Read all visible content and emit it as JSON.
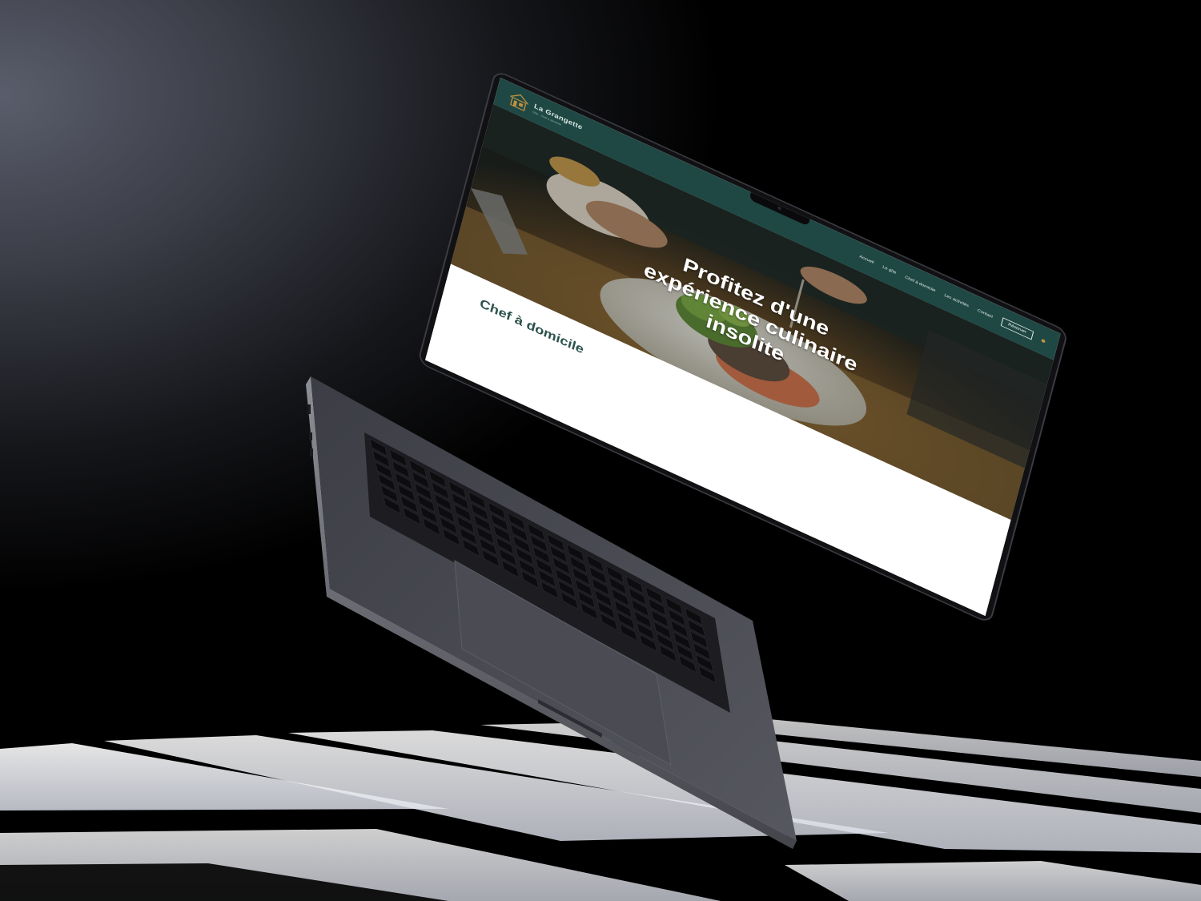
{
  "navbar": {
    "brand_name": "La Grangette",
    "brand_tagline": "Gîte · Chef à domicile",
    "links": [
      {
        "label": "Accueil"
      },
      {
        "label": "Le gîte"
      },
      {
        "label": "Chef à domicile"
      },
      {
        "label": "Les activités"
      },
      {
        "label": "Contact"
      }
    ],
    "cta_label": "Réserver"
  },
  "hero": {
    "title": "Profitez d'une expérience culinaire insolite",
    "subtitle": ""
  },
  "section": {
    "title": "Chef à domicile"
  },
  "colors": {
    "brand_green": "#1f4844",
    "section_title": "#2b524c",
    "accent_gold": "#c2923f"
  }
}
